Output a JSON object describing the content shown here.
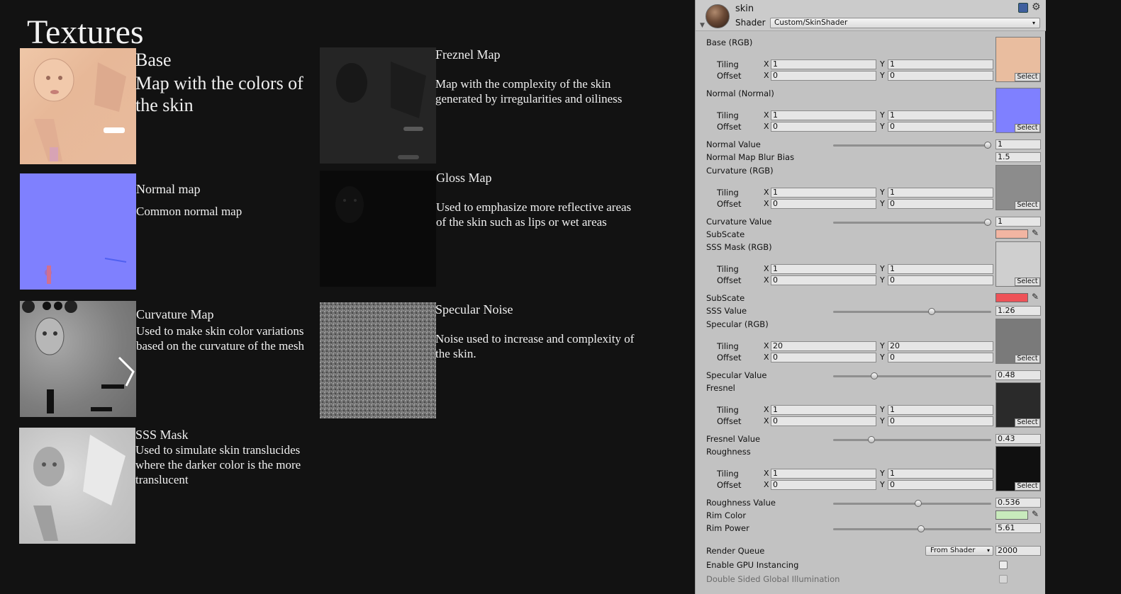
{
  "doc": {
    "title": "Textures",
    "items": [
      {
        "title": "Base",
        "desc": "Map with the colors of the skin",
        "icon": "base-texture-thumbnail"
      },
      {
        "title": "Normal map",
        "desc": "Common normal map",
        "icon": "normal-texture-thumbnail"
      },
      {
        "title": "Curvature Map",
        "desc": "Used to make skin color variations based on the curvature of the mesh",
        "icon": "curvature-texture-thumbnail"
      },
      {
        "title": "SSS Mask",
        "desc": "Used to simulate skin translucides where the darker color is the more translucent",
        "icon": "sss-mask-thumbnail"
      },
      {
        "title": "Freznel Map",
        "desc": "Map with the complexity of the skin generated by irregularities and oiliness",
        "icon": "fresnel-texture-thumbnail"
      },
      {
        "title": "Gloss Map",
        "desc": "Used to emphasize more reflective areas of the skin such as lips or wet areas",
        "icon": "gloss-texture-thumbnail"
      },
      {
        "title": "Specular Noise",
        "desc": "Noise used to increase and complexity of the skin.",
        "icon": "noise-texture-thumbnail"
      }
    ]
  },
  "inspector": {
    "material_name": "skin",
    "shader_label": "Shader",
    "shader_value": "Custom/SkinShader",
    "select_label": "Select",
    "tiling_label": "Tiling",
    "offset_label": "Offset",
    "x_label": "X",
    "y_label": "Y",
    "textures": [
      {
        "label": "Base (RGB)",
        "tiling_x": "1",
        "tiling_y": "1",
        "offset_x": "0",
        "offset_y": "0",
        "swatch": "#e9bd9f"
      },
      {
        "label": "Normal (Normal)",
        "tiling_x": "1",
        "tiling_y": "1",
        "offset_x": "0",
        "offset_y": "0",
        "swatch": "#7f80ff"
      },
      {
        "label": "Curvature (RGB)",
        "tiling_x": "1",
        "tiling_y": "1",
        "offset_x": "0",
        "offset_y": "0",
        "swatch": "#8c8c8c"
      },
      {
        "label": "SSS Mask (RGB)",
        "tiling_x": "1",
        "tiling_y": "1",
        "offset_x": "0",
        "offset_y": "0",
        "swatch": "#cfcfcf"
      },
      {
        "label": "Specular (RGB)",
        "tiling_x": "20",
        "tiling_y": "20",
        "offset_x": "0",
        "offset_y": "0",
        "swatch": "#7a7a7a"
      },
      {
        "label": "Fresnel",
        "tiling_x": "1",
        "tiling_y": "1",
        "offset_x": "0",
        "offset_y": "0",
        "swatch": "#2a2a2a"
      },
      {
        "label": "Roughness",
        "tiling_x": "1",
        "tiling_y": "1",
        "offset_x": "0",
        "offset_y": "0",
        "swatch": "#101010"
      }
    ],
    "normal_value": {
      "label": "Normal Value",
      "value": "1",
      "fraction": 1.0
    },
    "normal_blur": {
      "label": "Normal Map Blur Bias",
      "value": "1.5"
    },
    "curvature_value": {
      "label": "Curvature Value",
      "value": "1",
      "fraction": 1.0
    },
    "subscate1": {
      "label": "SubScate",
      "color": "#f2b5a2"
    },
    "subscate2": {
      "label": "SubScate",
      "color": "#ee5258"
    },
    "sss_value": {
      "label": "SSS Value",
      "value": "1.26",
      "fraction": 0.63
    },
    "specular_value": {
      "label": "Specular Value",
      "value": "0.48",
      "fraction": 0.25
    },
    "fresnel_value": {
      "label": "Fresnel Value",
      "value": "0.43",
      "fraction": 0.23
    },
    "roughness_value": {
      "label": "Roughness Value",
      "value": "0.536",
      "fraction": 0.54
    },
    "rim_color": {
      "label": "Rim Color",
      "color": "#c8eabc"
    },
    "rim_power": {
      "label": "Rim Power",
      "value": "5.61",
      "fraction": 0.56
    },
    "render_queue": {
      "label": "Render Queue",
      "mode": "From Shader",
      "value": "2000"
    },
    "gpu_instancing": {
      "label": "Enable GPU Instancing",
      "checked": false
    },
    "double_sided_gi": {
      "label": "Double Sided Global Illumination",
      "checked": false
    }
  }
}
